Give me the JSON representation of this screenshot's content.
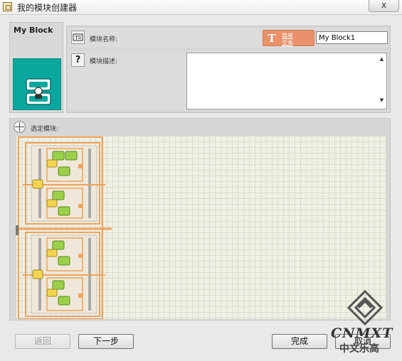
{
  "window": {
    "title": "我的模块创建器",
    "close_label": "x"
  },
  "block": {
    "name": "My Block"
  },
  "form": {
    "name_label": "模块名称:",
    "name_value": "My Block1",
    "text_button_line1": "简单",
    "text_button_line2": "文本",
    "text_button_icon": "T",
    "desc_label": "模块描述:",
    "desc_value": "",
    "help_icon": "?",
    "scroll_up": "▲",
    "scroll_down": "▼"
  },
  "selection": {
    "label": "选定模块:"
  },
  "footer": {
    "back_label": "返回",
    "next_label": "下一步",
    "finish_label": "完成",
    "cancel_label": "取消"
  },
  "watermark": {
    "line1": "CNMXT",
    "line2": "中文乐高"
  },
  "colors": {
    "block_teal": "#0aa79e",
    "accent_orange": "#e9916a",
    "beam_orange": "#f0a35a"
  }
}
